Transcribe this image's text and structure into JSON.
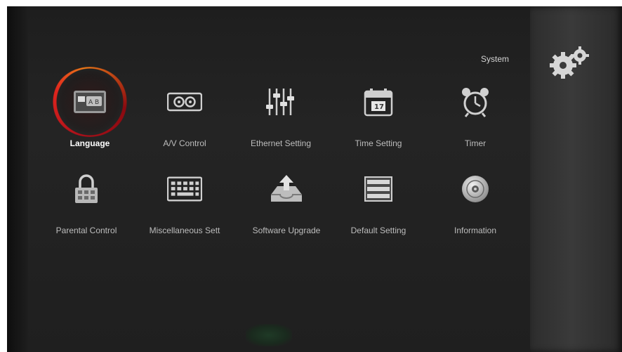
{
  "caption": "",
  "header": {
    "title": "System"
  },
  "menu": [
    {
      "label": "Language",
      "icon": "language-icon",
      "selected": true
    },
    {
      "label": "A/V Control",
      "icon": "av-control-icon",
      "selected": false
    },
    {
      "label": "Ethernet Setting",
      "icon": "ethernet-sliders-icon",
      "selected": false
    },
    {
      "label": "Time Setting",
      "icon": "calendar-icon",
      "selected": false
    },
    {
      "label": "Timer",
      "icon": "alarm-clock-icon",
      "selected": false
    },
    {
      "label": "Parental Control",
      "icon": "lock-icon",
      "selected": false
    },
    {
      "label": "Miscellaneous Sett",
      "icon": "keyboard-icon",
      "selected": false
    },
    {
      "label": "Software Upgrade",
      "icon": "upgrade-tray-icon",
      "selected": false
    },
    {
      "label": "Default Setting",
      "icon": "default-settings-icon",
      "selected": false
    },
    {
      "label": "Information",
      "icon": "info-disc-icon",
      "selected": false
    }
  ],
  "colors": {
    "focus_ring": "#e0261e",
    "focus_ring_accent": "#f07a18",
    "label": "#bdbdbd",
    "selected_label": "#ffffff"
  }
}
